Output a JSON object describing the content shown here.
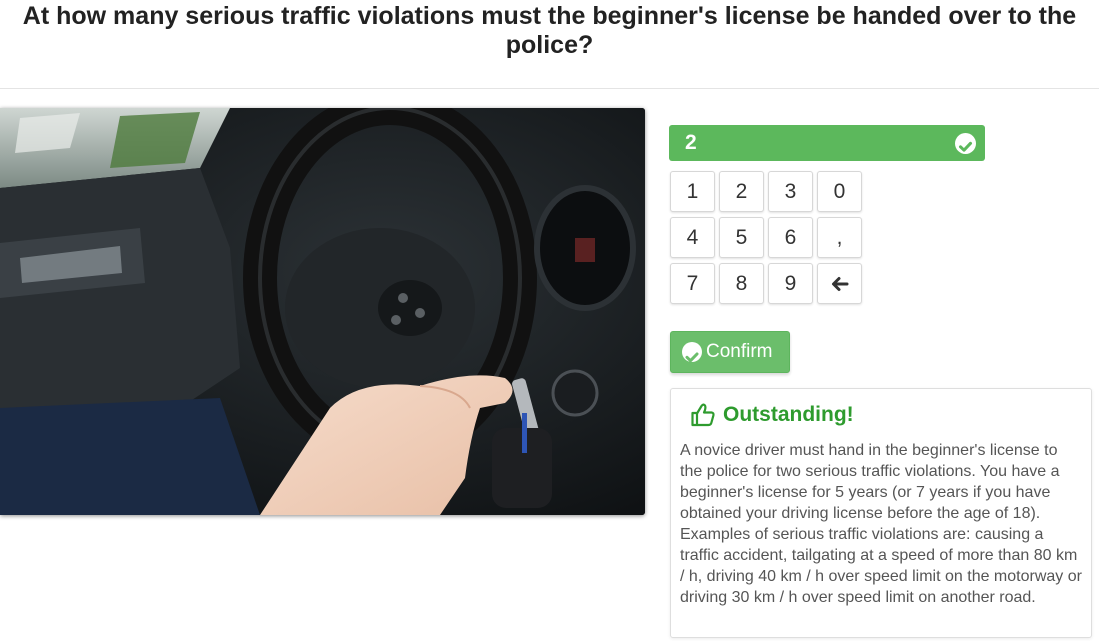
{
  "question": {
    "text": "At how many serious traffic violations must the beginner's license be handed over to the police?"
  },
  "answer": {
    "value": "2",
    "status_icon": "check-circle-icon"
  },
  "keypad": {
    "keys": [
      "1",
      "2",
      "3",
      "0",
      "4",
      "5",
      "6",
      ",",
      "7",
      "8",
      "9"
    ],
    "backspace_icon": "arrow-left-icon"
  },
  "confirm": {
    "label": "Confirm",
    "icon": "check-circle-icon"
  },
  "feedback": {
    "icon": "thumbs-up-icon",
    "title": "Outstanding!",
    "text": "A novice driver must hand in the beginner's license to the police for two serious traffic violations. You have a beginner's license for 5 years (or 7 years if you have obtained your driving license before the age of 18). Examples of serious traffic violations are: causing a traffic accident, tailgating at a speed of more than 80 km / h, driving 40 km / h over speed limit on the motorway or driving 30 km / h over speed limit on another road."
  },
  "colors": {
    "success": "#5cb85c",
    "success_text": "#2e9b2e"
  }
}
